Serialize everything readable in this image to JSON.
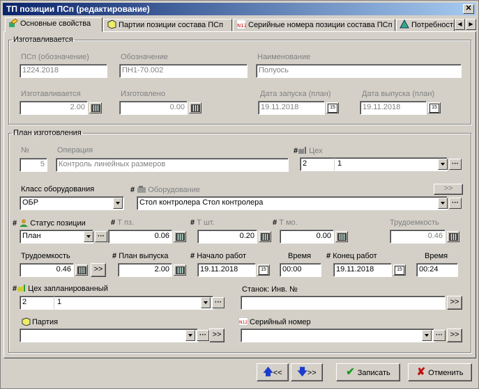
{
  "window": {
    "title": "ТП позиции ПСп (редактирование)",
    "close": "✕"
  },
  "tabs": [
    {
      "label": "Основные свойства"
    },
    {
      "label": "Партии позиции состава ПСп"
    },
    {
      "label": "Серийные номера позиции состава ПСп"
    },
    {
      "label": "Потребность"
    }
  ],
  "manufactured": {
    "legend": "Изготавливается",
    "psp_label": "ПСп (обозначение)",
    "psp_value": "1224.2018",
    "designation_label": "Обозначение",
    "designation_value": "ПН1-70.002",
    "name_label": "Наименование",
    "name_value": "Полуось",
    "qty_label": "Изготавливается",
    "qty_value": "2.00",
    "made_label": "Изготовлено",
    "made_value": "0.00",
    "start_label": "Дата запуска (план)",
    "start_value": "19.11.2018",
    "release_label": "Дата выпуска (план)",
    "release_value": "19.11.2018"
  },
  "plan": {
    "legend": "План изготовления",
    "no_label": "№",
    "no_value": "5",
    "op_label": "Операция",
    "op_value": "Контроль линейных размеров",
    "shop_label": "Цех",
    "shop_code": "2",
    "shop_name": "1",
    "eqclass_label": "Класс оборудования",
    "eqclass_value": "ОБР",
    "equipment_label": "Оборудование",
    "equipment_value": "Стол контролера  Стол контролера",
    "equipment_btn": ">>",
    "status_label": "Статус позиции",
    "status_value": "План",
    "tpz_label": "Т пз.",
    "tpz_value": "0.06",
    "tsht_label": "Т шт.",
    "tsht_value": "0.20",
    "tmo_label": "Т мо.",
    "tmo_value": "0.00",
    "labor_ro_label": "Трудоемкость",
    "labor_ro_value": "0.46",
    "labor_label": "Трудоемкость",
    "labor_value": "0.46",
    "labor_btn": ">>",
    "plan_release_label": "План выпуска",
    "plan_release_value": "2.00",
    "work_start_label": "Начало работ",
    "work_start_value": "19.11.2018",
    "time1_label": "Время",
    "time1_value": "00:00",
    "work_end_label": "Конец работ",
    "work_end_value": "19.11.2018",
    "time2_label": "Время",
    "time2_value": "00:24",
    "planned_shop_label": "Цех запланированный",
    "planned_shop_code": "2",
    "planned_shop_name": "1",
    "machine_label": "Станок: Инв. №",
    "machine_value": "",
    "machine_btn": ">>",
    "batch_label": "Партия",
    "batch_value": "",
    "batch_btn": ">>",
    "serial_label": "Серийный номер",
    "serial_value": "",
    "serial_btn": ">>",
    "hash": "#"
  },
  "footer": {
    "prev_label": "<<",
    "next_label": ">>",
    "save_label": "Записать",
    "cancel_label": "Отменить"
  }
}
